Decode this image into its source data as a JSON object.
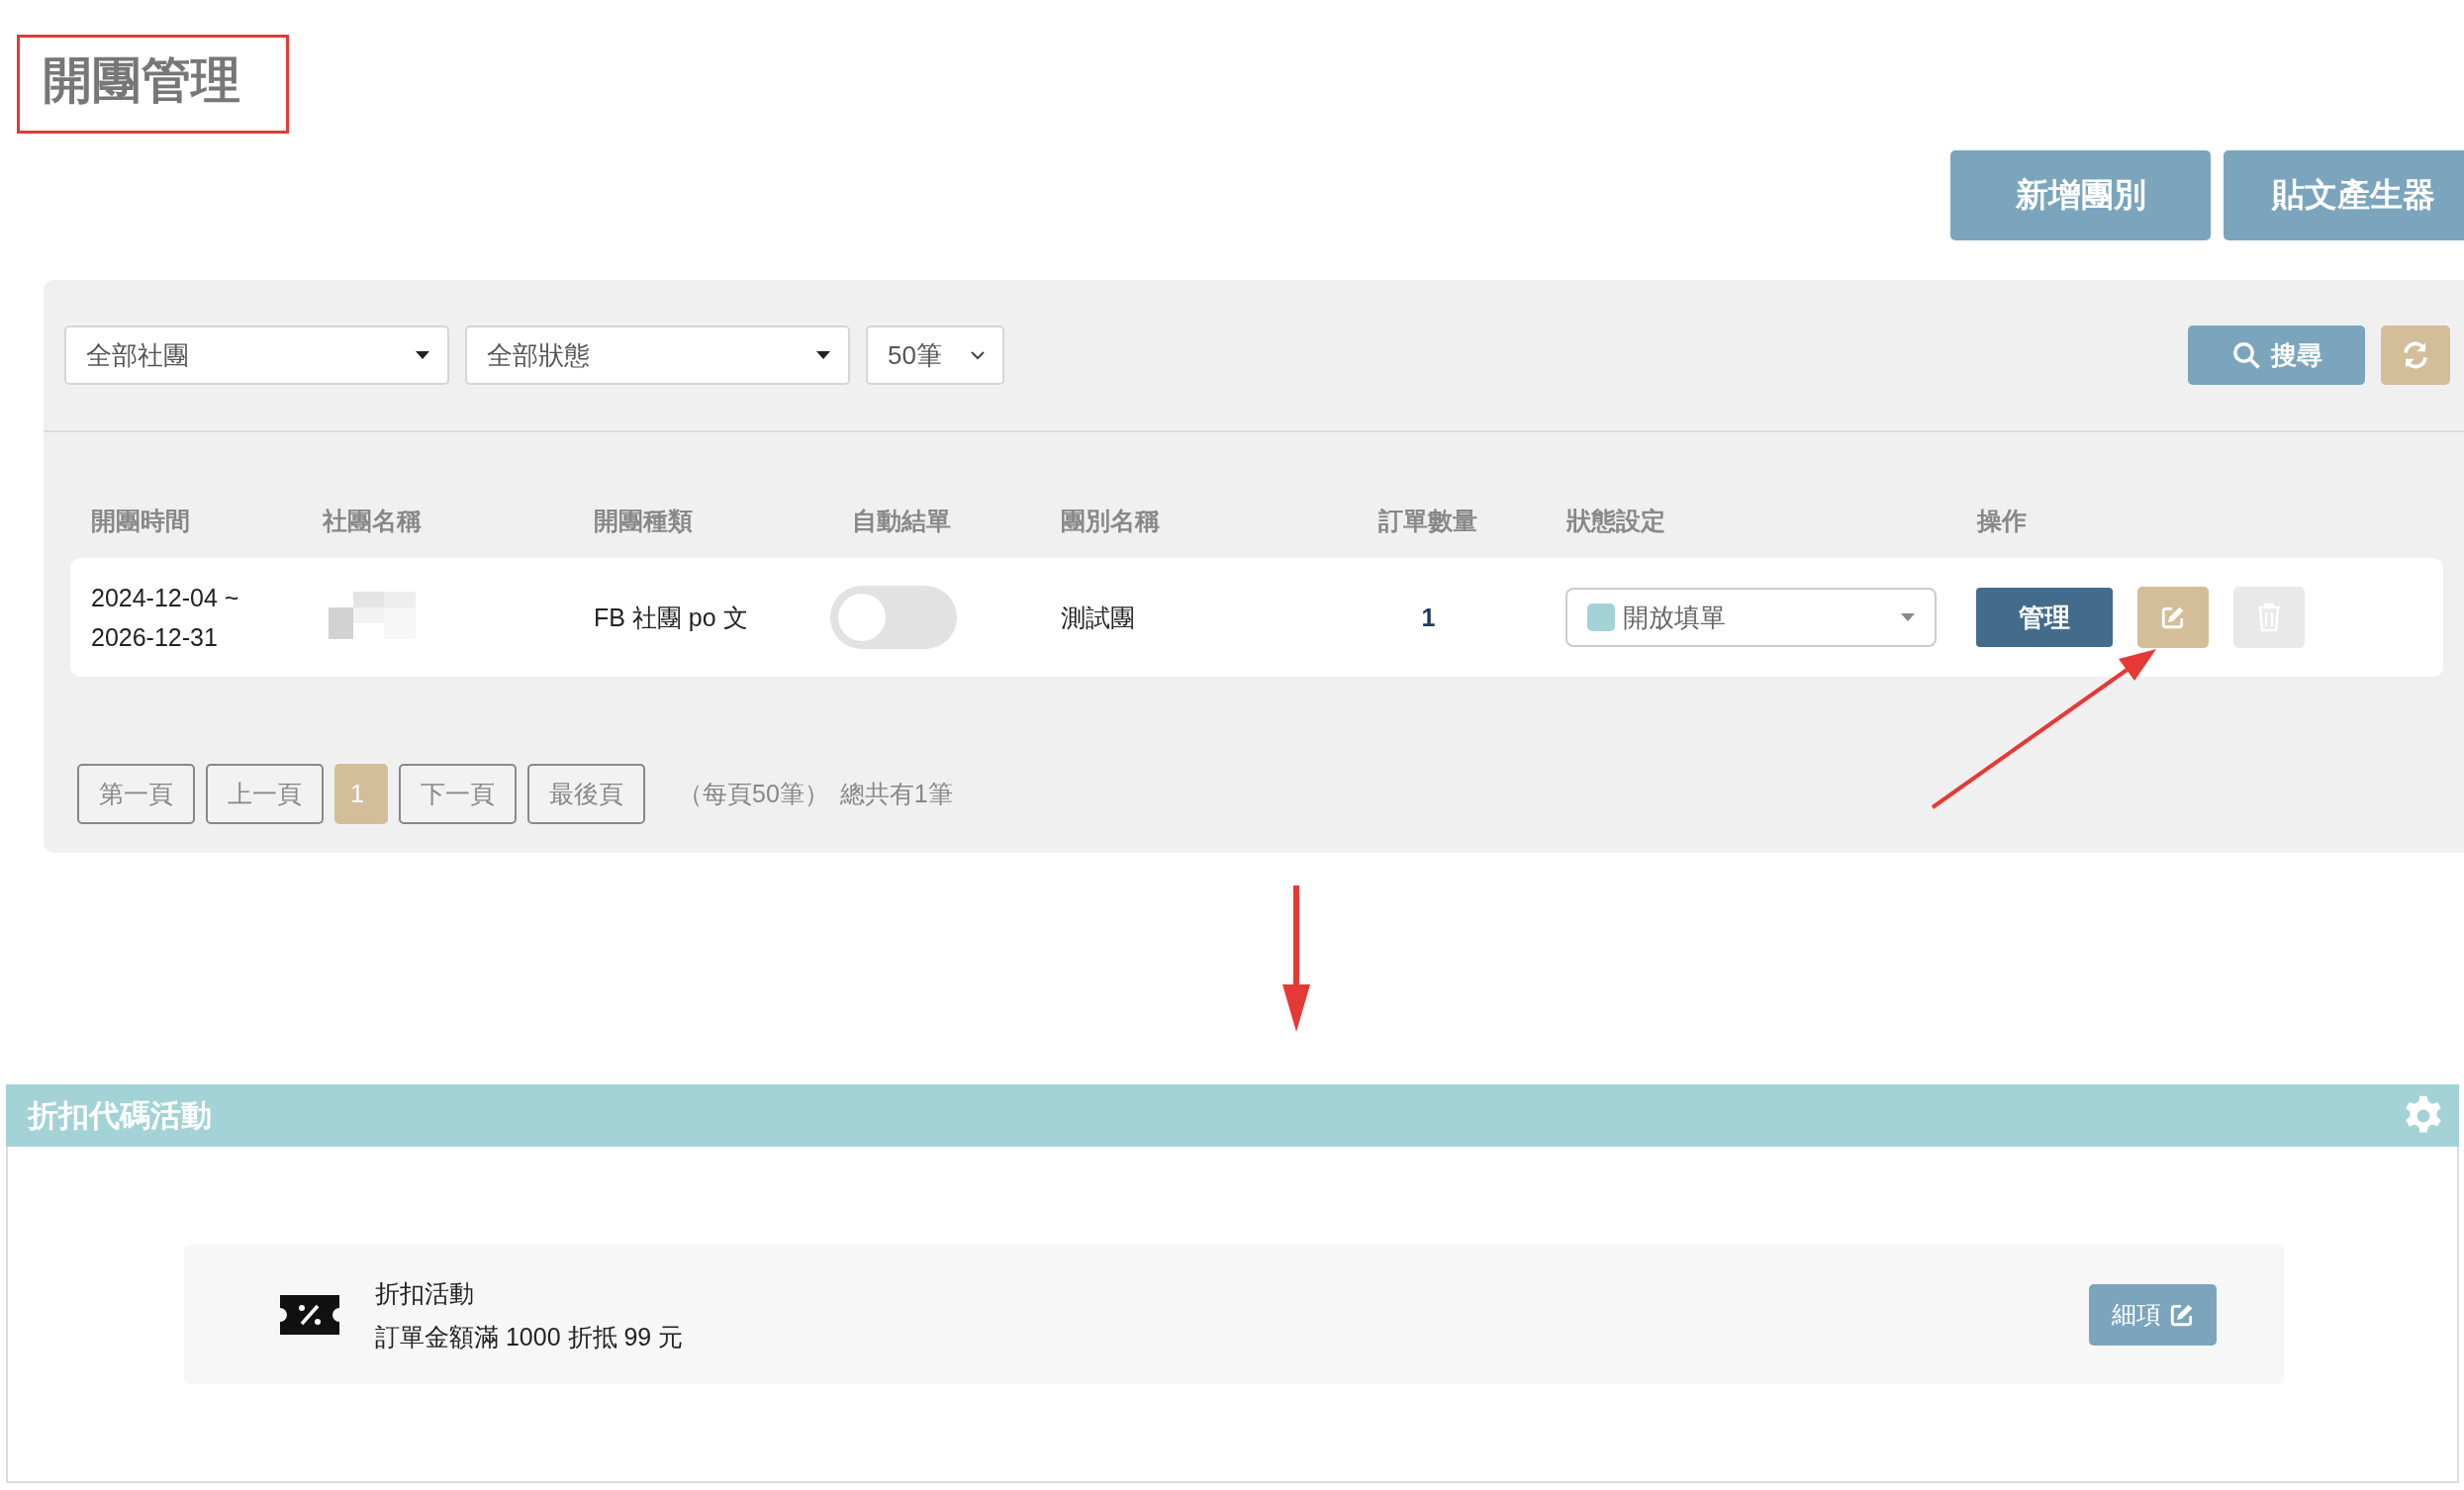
{
  "page": {
    "title": "開團管理"
  },
  "header_buttons": [
    "新增團別",
    "貼文產生器"
  ],
  "filters": [
    {
      "kind": "select",
      "value": "全部社團"
    },
    {
      "kind": "select",
      "value": "全部狀態"
    },
    {
      "kind": "compact",
      "value": "50筆"
    }
  ],
  "search_button": "搜尋",
  "table": {
    "columns": [
      "開團時間",
      "社團名稱",
      "開團種類",
      "自動結單",
      "團別名稱",
      "訂單數量",
      "狀態設定",
      "操作"
    ],
    "rows": [
      {
        "period_start": "2024-12-04 ~",
        "period_end": "2026-12-31",
        "type": "FB 社團 po 文",
        "auto_close": false,
        "group_name": "測試團",
        "order_count": "1",
        "status": {
          "label": "開放填單",
          "color": "#a3d3d6"
        },
        "manage_button": "管理",
        "delete_disabled": true
      }
    ]
  },
  "pagination": {
    "buttons": [
      {
        "kind": "nav",
        "label": "第一頁",
        "selected": false
      },
      {
        "kind": "nav",
        "label": "上一頁",
        "selected": false
      },
      {
        "kind": "page",
        "label": "1",
        "selected": true
      },
      {
        "kind": "nav",
        "label": "下一頁",
        "selected": false
      },
      {
        "kind": "nav",
        "label": "最後頁",
        "selected": false
      }
    ],
    "per_page": "（每頁50筆）",
    "total": "總共有1筆"
  },
  "discount_panel": {
    "title": "折扣代碼活動",
    "items": [
      {
        "name": "折扣活動",
        "description": "訂單金額滿 1000 折抵 99 元",
        "button": "細項"
      }
    ]
  }
}
